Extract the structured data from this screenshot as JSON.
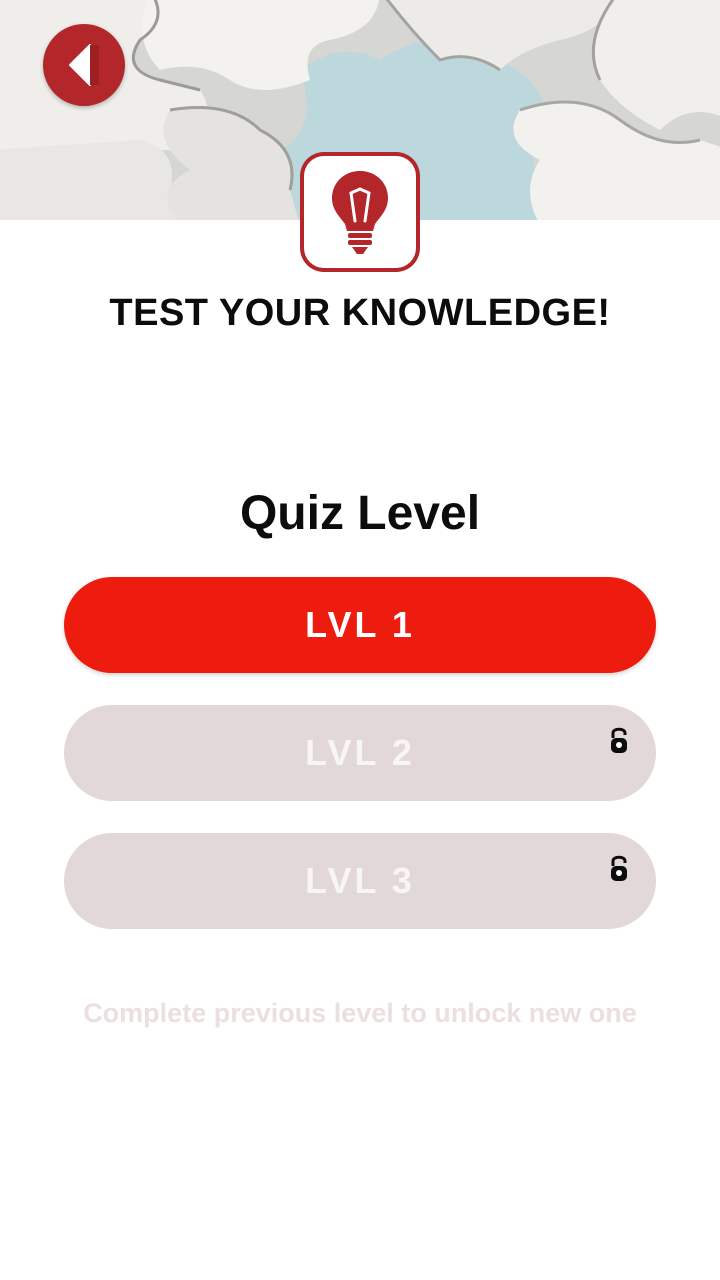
{
  "header": {
    "back_icon": "caret-left-icon",
    "logo_icon": "lightbulb-icon",
    "hero_image": "puzzle-pieces-photo",
    "accent_color": "#b3262a"
  },
  "headline": "TEST YOUR KNOWLEDGE!",
  "section_title": "Quiz Level",
  "levels": [
    {
      "label": "LVL 1",
      "state": "unlocked",
      "color": "#ee1c0e"
    },
    {
      "label": "LVL 2",
      "state": "locked",
      "icon": "lock-icon",
      "color": "#e3d8d8"
    },
    {
      "label": "LVL 3",
      "state": "locked",
      "icon": "lock-icon",
      "color": "#e3d8d8"
    }
  ],
  "hint": "Complete previous level to unlock new one"
}
